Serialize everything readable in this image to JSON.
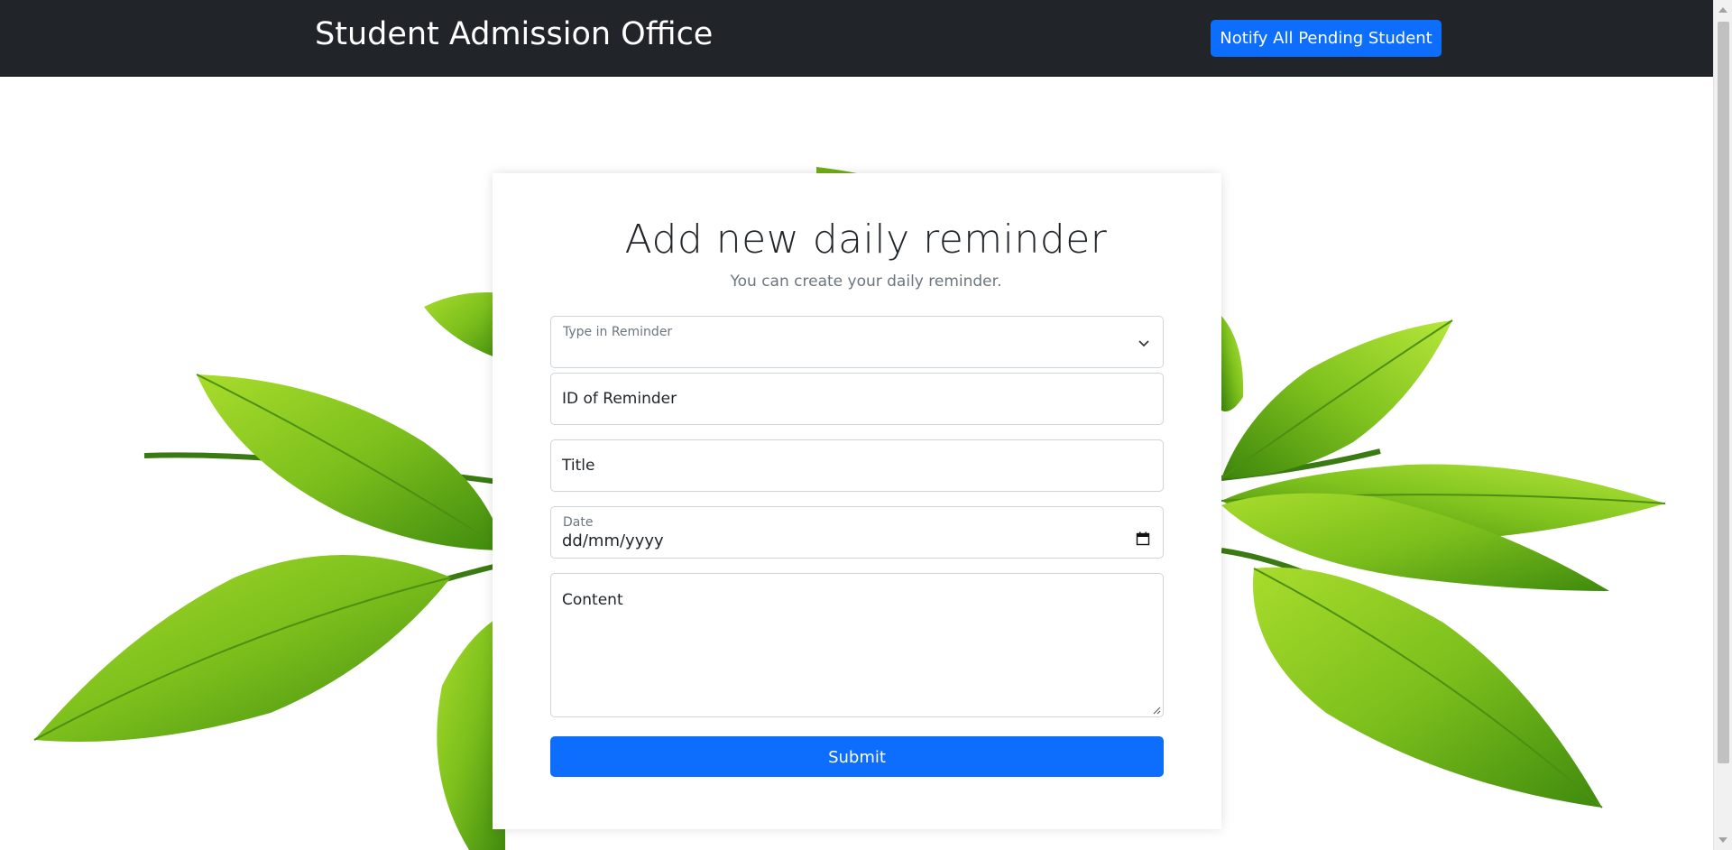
{
  "navbar": {
    "brand": "Student Admission Office",
    "notify_button": "Notify All Pending Student"
  },
  "form": {
    "title": "Add new daily reminder",
    "subtitle": "You can create your daily reminder.",
    "reminder_type_label": "Type in Reminder",
    "reminder_type_value": "",
    "reminder_id_placeholder": "ID of Reminder",
    "title_placeholder": "Title",
    "date_label": "Date",
    "date_value": "dd/mm/yyyy",
    "content_placeholder": "Content",
    "submit_label": "Submit"
  },
  "colors": {
    "navbar_bg": "#212529",
    "primary": "#0d6efd",
    "leaf_green": "#7cbf1c"
  },
  "icons": [
    "chevron-down-icon",
    "calendar-icon",
    "resize-grip-icon"
  ]
}
